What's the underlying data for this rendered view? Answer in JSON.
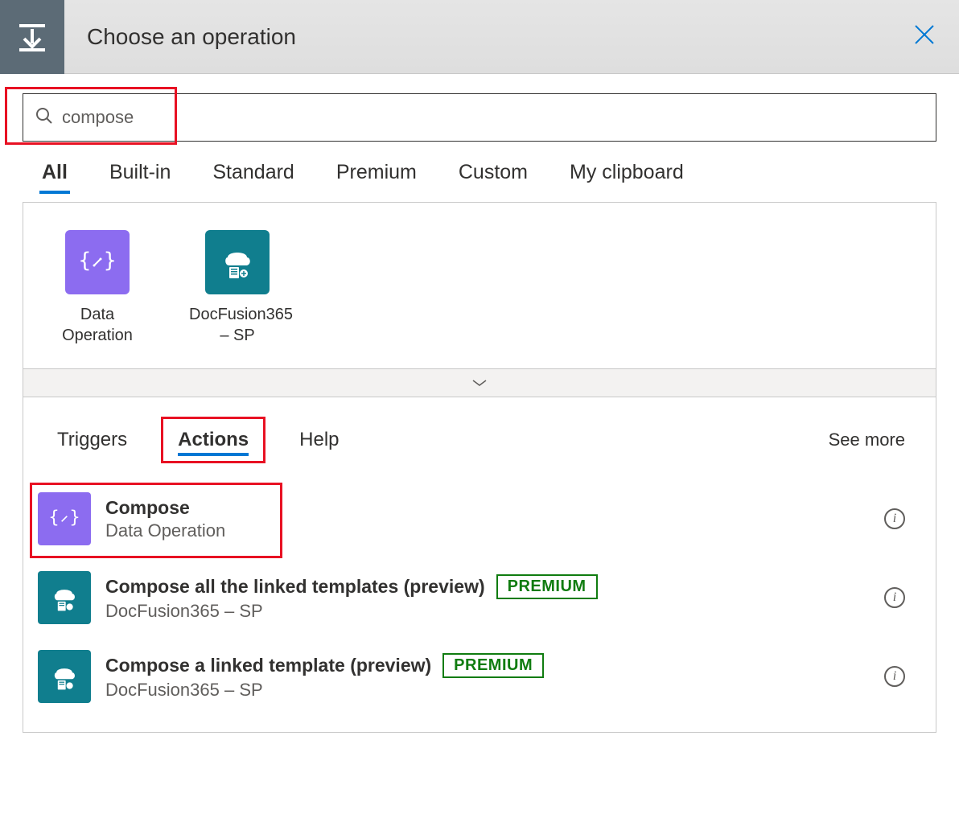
{
  "header": {
    "title": "Choose an operation"
  },
  "search": {
    "value": "compose"
  },
  "tabs": [
    {
      "label": "All",
      "active": true
    },
    {
      "label": "Built-in",
      "active": false
    },
    {
      "label": "Standard",
      "active": false
    },
    {
      "label": "Premium",
      "active": false
    },
    {
      "label": "Custom",
      "active": false
    },
    {
      "label": "My clipboard",
      "active": false
    }
  ],
  "connectors": [
    {
      "label": "Data Operation",
      "iconColor": "purple",
      "iconType": "data-op"
    },
    {
      "label": "DocFusion365 – SP",
      "iconColor": "teal",
      "iconType": "docfusion"
    }
  ],
  "subtabs": {
    "items": [
      {
        "label": "Triggers",
        "active": false
      },
      {
        "label": "Actions",
        "active": true
      },
      {
        "label": "Help",
        "active": false
      }
    ],
    "seeMore": "See more"
  },
  "actions": [
    {
      "title": "Compose",
      "subtitle": "Data Operation",
      "iconColor": "purple",
      "iconType": "data-op",
      "premium": false,
      "highlight": true
    },
    {
      "title": "Compose all the linked templates (preview)",
      "subtitle": "DocFusion365 – SP",
      "iconColor": "teal",
      "iconType": "docfusion",
      "premium": true,
      "highlight": false
    },
    {
      "title": "Compose a linked template (preview)",
      "subtitle": "DocFusion365 – SP",
      "iconColor": "teal",
      "iconType": "docfusion",
      "premium": true,
      "highlight": false
    }
  ],
  "badge": {
    "premium": "PREMIUM"
  }
}
